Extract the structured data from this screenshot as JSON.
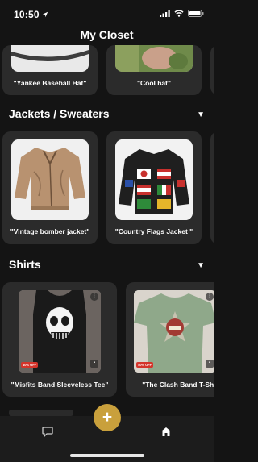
{
  "status": {
    "time": "10:50"
  },
  "header": {
    "title": "My Closet"
  },
  "hats": {
    "items": [
      {
        "label": "\"Yankee Baseball Hat\""
      },
      {
        "label": "\"Cool hat\""
      }
    ]
  },
  "jackets": {
    "title": "Jackets / Sweaters",
    "toggle": "▼",
    "items": [
      {
        "label": "\"Vintage bomber jacket\""
      },
      {
        "label": "\"Country Flags Jacket \""
      }
    ]
  },
  "shirts": {
    "title": "Shirts",
    "toggle": "▼",
    "items": [
      {
        "label": "\"Misfits Band Sleeveless Tee\"",
        "badge": "40% OFF"
      },
      {
        "label": "\"The Clash Band T-Shirt\"",
        "badge": "40% OFF"
      }
    ]
  },
  "bottom_nav": {
    "add_label": "+"
  },
  "icons": {
    "location": "location-arrow-icon",
    "signal": "cellular-signal-icon",
    "wifi": "wifi-icon",
    "battery": "battery-icon",
    "chat": "chat-bubble-icon",
    "home": "home-icon"
  },
  "colors": {
    "accent": "#c9a03c",
    "background": "#141414",
    "card": "#2b2b2b"
  }
}
